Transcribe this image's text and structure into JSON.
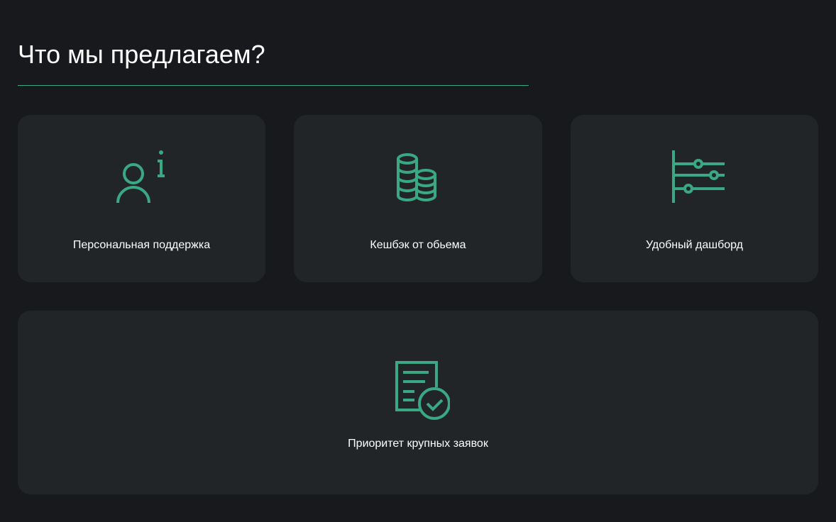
{
  "section": {
    "title": "Что мы предлагаем?"
  },
  "accent_color": "#3aa882",
  "cards": [
    {
      "label": "Персональная поддержка",
      "icon": "user-info-icon"
    },
    {
      "label": "Кешбэк от обьема",
      "icon": "coins-stack-icon"
    },
    {
      "label": "Удобный дашборд",
      "icon": "dashboard-sliders-icon"
    },
    {
      "label": "Приоритет крупных заявок",
      "icon": "document-check-icon"
    }
  ]
}
